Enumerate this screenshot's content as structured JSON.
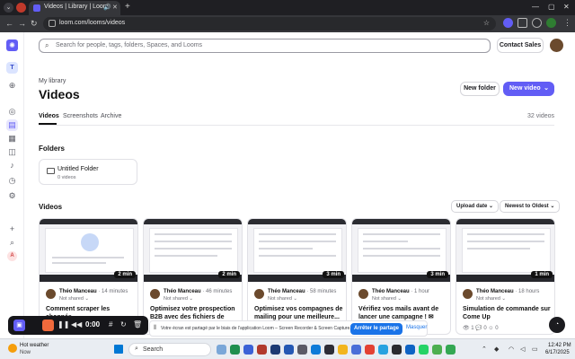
{
  "browser": {
    "tab_title": "Videos | Library | Loom",
    "url": "loom.com/looms/videos"
  },
  "rail": {
    "workspace_initial": "T",
    "account_initial": "A"
  },
  "header": {
    "search_placeholder": "Search for people, tags, folders, Spaces, and Looms",
    "contact_sales": "Contact Sales"
  },
  "page": {
    "breadcrumb": "My library",
    "title": "Videos",
    "new_folder": "New folder",
    "new_video": "New video",
    "tabs": [
      "Videos",
      "Screenshots",
      "Archive"
    ],
    "count": "32 videos"
  },
  "folders": {
    "heading": "Folders",
    "items": [
      {
        "name": "Untitled Folder",
        "meta": "0 videos"
      }
    ]
  },
  "videos": {
    "heading": "Videos",
    "sort_field": "Upload date",
    "sort_order": "Newest to Oldest",
    "cards": [
      {
        "author": "Théo Manceau",
        "time": "· 14 minutes",
        "shared": "Not shared ⌄",
        "title": "Comment scraper les abonnés",
        "duration": "2 min",
        "stats": ""
      },
      {
        "author": "Théo Manceau",
        "time": "· 46 minutes",
        "shared": "Not shared ⌄",
        "title": "Optimisez votre prospection B2B avec des fichiers de contacts...",
        "duration": "2 min",
        "stats": ""
      },
      {
        "author": "Théo Manceau",
        "time": "· 58 minutes",
        "shared": "Not shared ⌄",
        "title": "Optimisez vos compagnes de mailing pour une meilleure...",
        "duration": "3 min",
        "stats": ""
      },
      {
        "author": "Théo Manceau",
        "time": "· 1 hour",
        "shared": "Not shared ⌄",
        "title": "Vérifiez vos mails avant de lancer une campagne ! ✉",
        "duration": "3 min",
        "stats": ""
      },
      {
        "author": "Théo Manceau",
        "time": "· 18 hours",
        "shared": "Not shared ⌄",
        "title": "Simulation de commande sur Come Up",
        "duration": "1 min",
        "stats": "👁 1   💬 0   ☺ 0"
      }
    ]
  },
  "recorder": {
    "time": "0:00"
  },
  "share_banner": {
    "text": "Votre écran est partagé par le biais de l'application Loom – Screen Recorder & Screen Capture.",
    "stop": "Arrêter le partage",
    "hide": "Masquer"
  },
  "taskbar": {
    "weather_title": "Hot weather",
    "weather_sub": "Now",
    "search": "Search",
    "time": "12:42 PM",
    "date": "6/17/2025"
  },
  "colors": {
    "accent": "#625df5",
    "share_blue": "#1a73e8",
    "record_orange": "#f06a3c"
  }
}
